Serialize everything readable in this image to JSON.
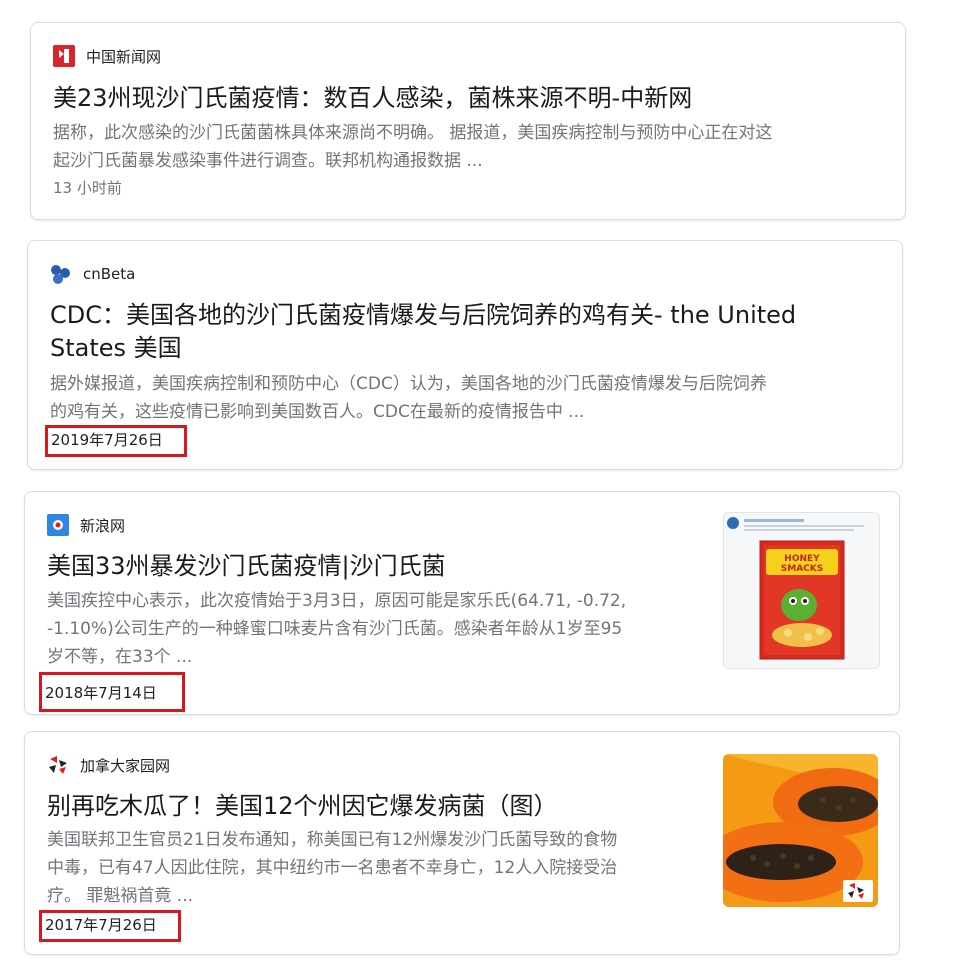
{
  "results": [
    {
      "source": "中国新闻网",
      "title": "美23州现沙门氏菌疫情：数百人感染，菌株来源不明-中新网",
      "snippet": [
        "据称，此次感染的沙门氏菌菌株具体来源尚不明确。 据报道，美国疾病控制与预防中心正在对这",
        "起沙门氏菌暴发感染事件进行调查。联邦机构通报数据 ..."
      ],
      "date": "13 小时前",
      "icon": "chinanews-logo-icon"
    },
    {
      "source": "cnBeta",
      "title": [
        "CDC：美国各地的沙门氏菌疫情爆发与后院饲养的鸡有关- the United",
        "States 美国"
      ],
      "snippet": [
        "据外媒报道，美国疾病控制和预防中心（CDC）认为，美国各地的沙门氏菌疫情爆发与后院饲养",
        "的鸡有关，这些疫情已影响到美国数百人。CDC在最新的疫情报告中 ..."
      ],
      "date": "2019年7月26日",
      "icon": "cnbeta-logo-icon"
    },
    {
      "source": "新浪网",
      "title": "美国33州暴发沙门氏菌疫情|沙门氏菌",
      "snippet": [
        "美国疾控中心表示，此次疫情始于3月3日，原因可能是家乐氏(64.71, -0.72,",
        "-1.10%)公司生产的一种蜂蜜口味麦片含有沙门氏菌。感染者年龄从1岁至95",
        "岁不等，在33个 ..."
      ],
      "date": "2018年7月14日",
      "icon": "sina-logo-icon",
      "thumbnail": "cereal-box-thumbnail",
      "thumbnail_text": "HONEY SMACKS"
    },
    {
      "source": "加拿大家园网",
      "title": "别再吃木瓜了！美国12个州因它爆发病菌（图）",
      "snippet": [
        "美国联邦卫生官员21日发布通知，称美国已有12州爆发沙门氏菌导致的食物",
        "中毒，已有47人因此住院，其中纽约市一名患者不幸身亡，12人入院接受治",
        "疗。 罪魁祸首竟 ..."
      ],
      "date": "2017年7月26日",
      "icon": "canadameet-logo-icon",
      "thumbnail": "papaya-thumbnail"
    }
  ],
  "colors": {
    "highlight_border": "#d7191f",
    "snippet": "#70757a",
    "border": "#dadce0"
  }
}
